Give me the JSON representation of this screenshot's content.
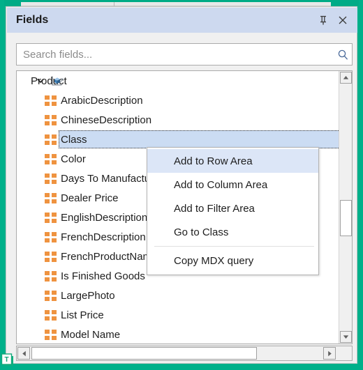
{
  "panel": {
    "title": "Fields",
    "pin_icon": "pin-icon",
    "close_icon": "close-icon"
  },
  "search": {
    "placeholder": "Search fields...",
    "value": "",
    "icon": "search-icon"
  },
  "tree": {
    "root": {
      "label": "Product",
      "expanded": true,
      "expander_icon": "chevron-down-icon",
      "icon": "dimension-cube-icon"
    },
    "items": [
      {
        "label": "ArabicDescription",
        "icon": "attribute-icon",
        "selected": false
      },
      {
        "label": "ChineseDescription",
        "icon": "attribute-icon",
        "selected": false
      },
      {
        "label": "Class",
        "icon": "attribute-icon",
        "selected": true
      },
      {
        "label": "Color",
        "icon": "attribute-icon",
        "selected": false
      },
      {
        "label": "Days To Manufacture",
        "icon": "attribute-icon",
        "selected": false
      },
      {
        "label": "Dealer Price",
        "icon": "attribute-icon",
        "selected": false
      },
      {
        "label": "EnglishDescription",
        "icon": "attribute-icon",
        "selected": false
      },
      {
        "label": "FrenchDescription",
        "icon": "attribute-icon",
        "selected": false
      },
      {
        "label": "FrenchProductName",
        "icon": "attribute-icon",
        "selected": false
      },
      {
        "label": "Is Finished Goods",
        "icon": "attribute-icon",
        "selected": false
      },
      {
        "label": "LargePhoto",
        "icon": "attribute-icon",
        "selected": false
      },
      {
        "label": "List Price",
        "icon": "attribute-icon",
        "selected": false
      },
      {
        "label": "Model Name",
        "icon": "attribute-icon",
        "selected": false
      }
    ]
  },
  "context_menu": {
    "items": [
      {
        "label": "Add to Row Area",
        "highlighted": true,
        "separator_after": false
      },
      {
        "label": "Add to Column Area",
        "highlighted": false,
        "separator_after": false
      },
      {
        "label": "Add to Filter Area",
        "highlighted": false,
        "separator_after": false
      },
      {
        "label": "Go to Class",
        "highlighted": false,
        "separator_after": true
      },
      {
        "label": "Copy MDX query",
        "highlighted": false,
        "separator_after": false
      }
    ]
  },
  "scrollbars": {
    "vertical": {
      "up_icon": "scroll-up-arrow-icon",
      "down_icon": "scroll-down-arrow-icon",
      "thumb": "vertical-scroll-thumb"
    },
    "horizontal": {
      "left_icon": "scroll-left-arrow-icon",
      "right_icon": "scroll-right-arrow-icon",
      "thumb": "horizontal-scroll-thumb"
    }
  },
  "colors": {
    "selection_frame": "#00b08a",
    "header_bg": "#cdd9ef",
    "attribute_icon": "#ef9340",
    "row_selected_bg": "#cbdcf3",
    "menu_highlight_bg": "#dce6f7"
  },
  "corner": {
    "icon": "textbox-indicator-icon"
  }
}
